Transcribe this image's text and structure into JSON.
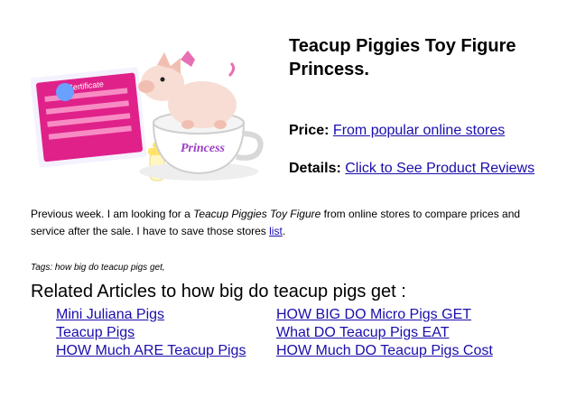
{
  "product": {
    "title": "Teacup Piggies Toy Figure Princess.",
    "image_alt": "Teacup Piggies Toy Figure Princess",
    "image_text": {
      "cup": "Princess",
      "card": "Certificate"
    },
    "price_label": "Price:",
    "price_link": "From popular online stores",
    "details_label": "Details:",
    "details_link": "Click to See Product Reviews"
  },
  "intro": {
    "part1": "Previous week. I am looking for a ",
    "product_name": "Teacup Piggies Toy Figure",
    "part2": " from online stores to compare prices and service after the sale. I have to save those stores ",
    "list_link": "list",
    "end": "."
  },
  "tags": "Tags: how big do teacup pigs get,",
  "related": {
    "heading": "Related Articles to how big do teacup pigs get :",
    "links": [
      "Mini Juliana Pigs",
      "HOW BIG DO Micro Pigs GET",
      "Teacup Pigs",
      "What DO Teacup Pigs EAT",
      "HOW Much ARE Teacup Pigs",
      "HOW Much DO Teacup Pigs Cost"
    ]
  },
  "colors": {
    "link": "#1a0dab",
    "card": "#e0218a",
    "cup_text": "#9b3fc4",
    "pig": "#f7ddd3"
  }
}
